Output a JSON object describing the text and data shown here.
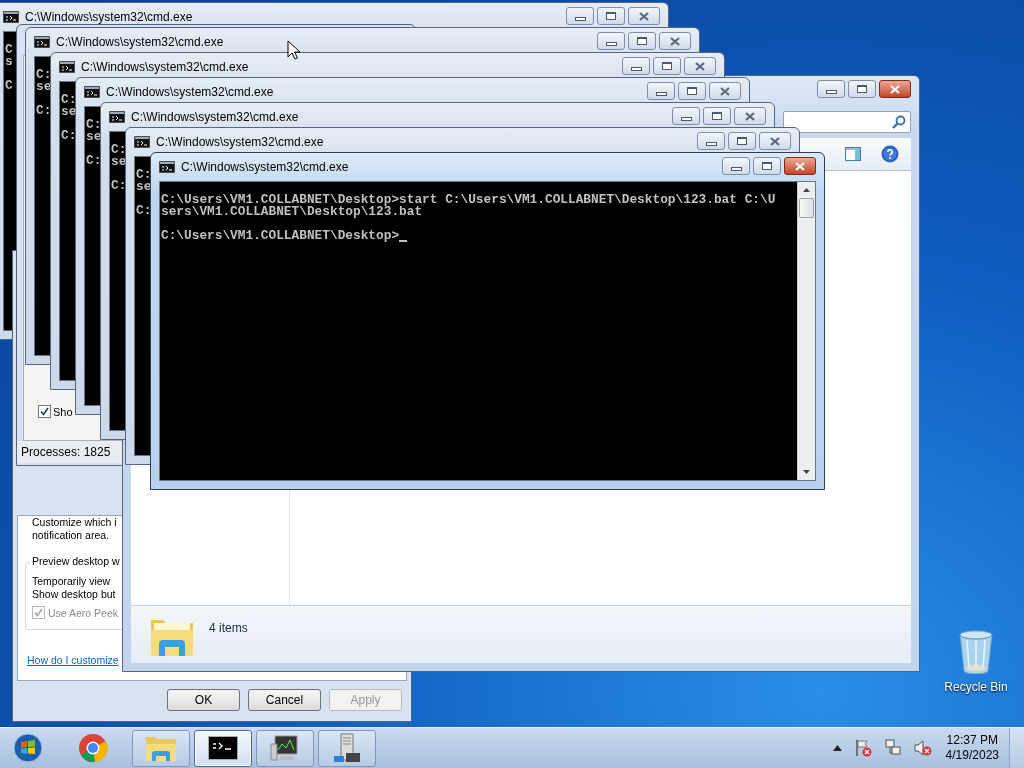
{
  "console_windows": [
    {
      "title": "C:\\Windows\\system32\\cmd.exe",
      "active": false,
      "output": [
        [
          "C",
          "s"
        ],
        [
          "C"
        ]
      ]
    },
    {
      "title": "C:\\Windows\\system32\\cmd.exe",
      "active": false,
      "output": [
        [
          "C:",
          "se"
        ],
        [
          "C:"
        ]
      ]
    },
    {
      "title": "C:\\Windows\\system32\\cmd.exe",
      "active": false,
      "output": [
        [
          "C:",
          "se"
        ],
        [
          "C:"
        ]
      ]
    },
    {
      "title": "C:\\Windows\\system32\\cmd.exe",
      "active": false,
      "output": [
        [
          "C:",
          "se"
        ],
        [
          "C:"
        ]
      ]
    },
    {
      "title": "C:\\Windows\\system32\\cmd.exe",
      "active": false,
      "output": [
        [
          "C:",
          "se"
        ],
        [
          "C:"
        ]
      ]
    },
    {
      "title": "C:\\Windows\\system32\\cmd.exe",
      "active": false,
      "output": [
        [
          "C:",
          "se"
        ],
        [
          "C:"
        ]
      ]
    },
    {
      "title": "C:\\Windows\\system32\\cmd.exe",
      "active": true,
      "cursor": true,
      "output": [
        [
          "C:\\Users\\VM1.COLLABNET\\Desktop>start C:\\Users\\VM1.COLLABNET\\Desktop\\123.bat C:\\U",
          "sers\\VM1.COLLABNET\\Desktop\\123.bat"
        ],
        [
          "C:\\Users\\VM1.COLLABNET\\Desktop>"
        ]
      ]
    }
  ],
  "task_manager": {
    "show_checkbox": {
      "label": "Sho",
      "checked": true
    },
    "status": "Processes: 1825"
  },
  "taskbar_properties": {
    "description": [
      "Customize which i",
      "notification area."
    ],
    "group": {
      "legend": "Preview desktop w",
      "lines": [
        "Temporarily view",
        "Show desktop but"
      ],
      "checkbox": {
        "label": "Use Aero Peek",
        "checked": true,
        "disabled": true
      }
    },
    "link": "How do I customize",
    "buttons": [
      {
        "label": "OK",
        "disabled": false
      },
      {
        "label": "Cancel",
        "disabled": false
      },
      {
        "label": "Apply",
        "disabled": true
      }
    ]
  },
  "explorer": {
    "status": "4 items"
  },
  "desktop_icons": [
    {
      "label": "Recycle Bin"
    }
  ],
  "taskbar": {
    "items": [
      {
        "kind": "start",
        "selected": false
      },
      {
        "kind": "chrome",
        "selected": false
      },
      {
        "kind": "folder",
        "selected": false
      },
      {
        "kind": "console",
        "selected": true
      },
      {
        "kind": "monitor",
        "selected": false
      },
      {
        "kind": "server",
        "selected": false
      }
    ],
    "tray": [
      {
        "kind": "caret"
      },
      {
        "kind": "flag"
      },
      {
        "kind": "network"
      },
      {
        "kind": "speaker"
      }
    ],
    "time": "12:37 PM",
    "date": "4/19/2023"
  }
}
